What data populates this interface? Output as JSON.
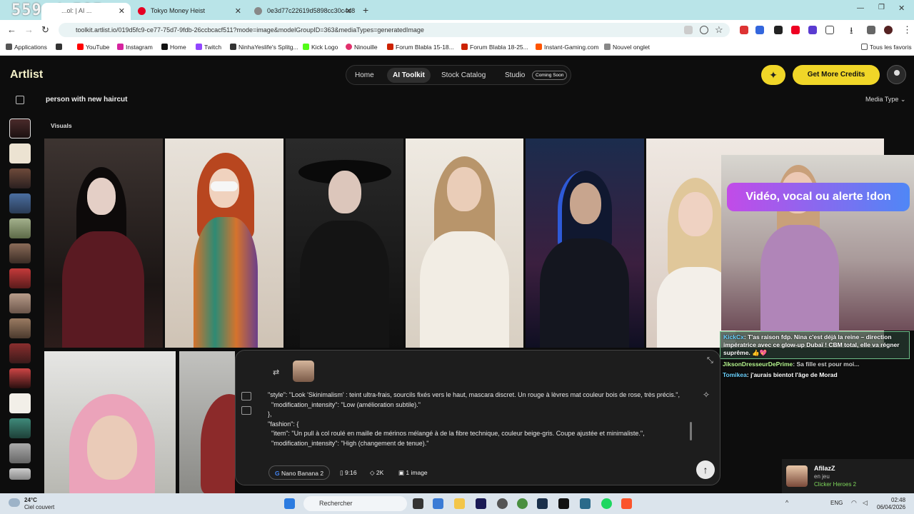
{
  "browser": {
    "tab_counter": "559 / 585",
    "tabs": [
      {
        "title": "Tokyo Money Heist",
        "color": "#e60023"
      },
      {
        "title": "0e3d77c22619d5898cc30c4d8",
        "color": "#777777"
      }
    ],
    "first_tab_title": "...ol: | AI ...",
    "url": "toolkit.artlist.io/019d5fc9-ce77-75d7-9fdb-26ccbcacf511?mode=image&modelGroupID=363&mediaTypes=generatedImage",
    "bookmarks": [
      {
        "label": "Applications",
        "color": "#555555"
      },
      {
        "label": "YouTube",
        "color": "#ff0000"
      },
      {
        "label": "Instagram",
        "color": "#d6249f"
      },
      {
        "label": "Home",
        "color": "#111111"
      },
      {
        "label": "Twitch",
        "color": "#9146ff"
      },
      {
        "label": "NinhaYeslife's Splitg...",
        "color": "#333333"
      },
      {
        "label": "Kick Logo",
        "color": "#53fc18"
      },
      {
        "label": "Ninouille",
        "color": "#e1306c"
      },
      {
        "label": "Forum Blabla 15-18...",
        "color": "#cc2200"
      },
      {
        "label": "Forum Blabla 18-25...",
        "color": "#cc2200"
      },
      {
        "label": "Instant-Gaming.com",
        "color": "#ff5400"
      },
      {
        "label": "Nouvel onglet",
        "color": "#888888"
      }
    ],
    "all_favorites": "Tous les favoris"
  },
  "app": {
    "logo": "Artlist",
    "nav": {
      "home": "Home",
      "ai_toolkit": "AI Toolkit",
      "stock": "Stock Catalog",
      "studio": "Studio",
      "coming_soon": "Coming Soon"
    },
    "credits_button": "Get More Credits",
    "query": "person with new haircut",
    "media_type": "Media Type",
    "visuals_label": "Visuals"
  },
  "overlay": {
    "banner": "Vidéo, vocal ou alerte !don",
    "chat": [
      {
        "user": "KickCx",
        "text": "T'as raison fdp. Nina c'est déjà la reine – direction impératrice avec ce glow-up Dubaï ! CBM total, elle va régner suprême. 👍💖"
      },
      {
        "user": "JiksonDresseurDePrime",
        "text": "Sa fille est pour moi..."
      },
      {
        "user": "Tomikea",
        "text": "j'aurais bientot l'âge de Morad"
      }
    ]
  },
  "prompt": {
    "text": "  \"style\": \"Look 'Skinimalism' : teint ultra-frais, sourcils fixés vers le haut, mascara discret. Un rouge à lèvres mat couleur bois de rose, très précis.\",\n    \"modification_intensity\": \"Low (amélioration subtile).\"\n  },\n  \"fashion\": {\n    \"item\": \"Un pull à col roulé en maille de mérinos mélangé à de la fibre technique, couleur beige-gris. Coupe ajustée et minimaliste.\",\n    \"modification_intensity\": \"High (changement de tenue).\"",
    "model": "Nano Banana 2",
    "ratio": "9:16",
    "resolution": "2K",
    "count": "1 image"
  },
  "notification": {
    "name": "AfilazZ",
    "status": "en jeu",
    "game": "Clicker Heroes 2"
  },
  "taskbar": {
    "temp": "24°C",
    "weather": "Ciel couvert",
    "search": "Rechercher",
    "lang": "ENG",
    "time": "02:48",
    "date": "06/04/2026"
  }
}
